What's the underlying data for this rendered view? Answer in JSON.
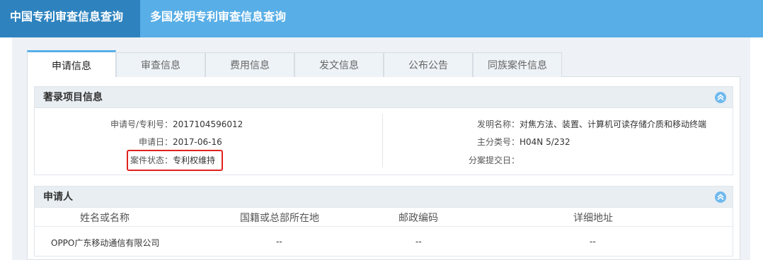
{
  "topnav": {
    "items": [
      "中国专利审查信息查询",
      "多国发明专利审查信息查询"
    ]
  },
  "tabs": [
    "申请信息",
    "审查信息",
    "费用信息",
    "发文信息",
    "公布公告",
    "同族案件信息"
  ],
  "biblio": {
    "title": "著录项目信息",
    "left": [
      {
        "label": "申请号/专利号：",
        "value": "2017104596012"
      },
      {
        "label": "申请日：",
        "value": "2017-06-16"
      },
      {
        "label": "案件状态：",
        "value": "专利权维持"
      }
    ],
    "right": [
      {
        "label": "发明名称：",
        "value": "对焦方法、装置、计算机可读存储介质和移动终端"
      },
      {
        "label": "主分类号：",
        "value": "H04N 5/232"
      },
      {
        "label": "分案提交日：",
        "value": ""
      }
    ]
  },
  "applicant": {
    "title": "申请人",
    "headers": [
      "姓名或名称",
      "国籍或总部所在地",
      "邮政编码",
      "详细地址"
    ],
    "rows": [
      [
        "OPPO广东移动通信有限公司",
        "--",
        "--",
        "--"
      ]
    ]
  },
  "colors": {
    "topbar": "#58aee6",
    "topbar_active": "#2e83bf",
    "highlight_box": "#e0221f"
  },
  "icons": {
    "collapse": "chevron-up-circle-icon"
  }
}
